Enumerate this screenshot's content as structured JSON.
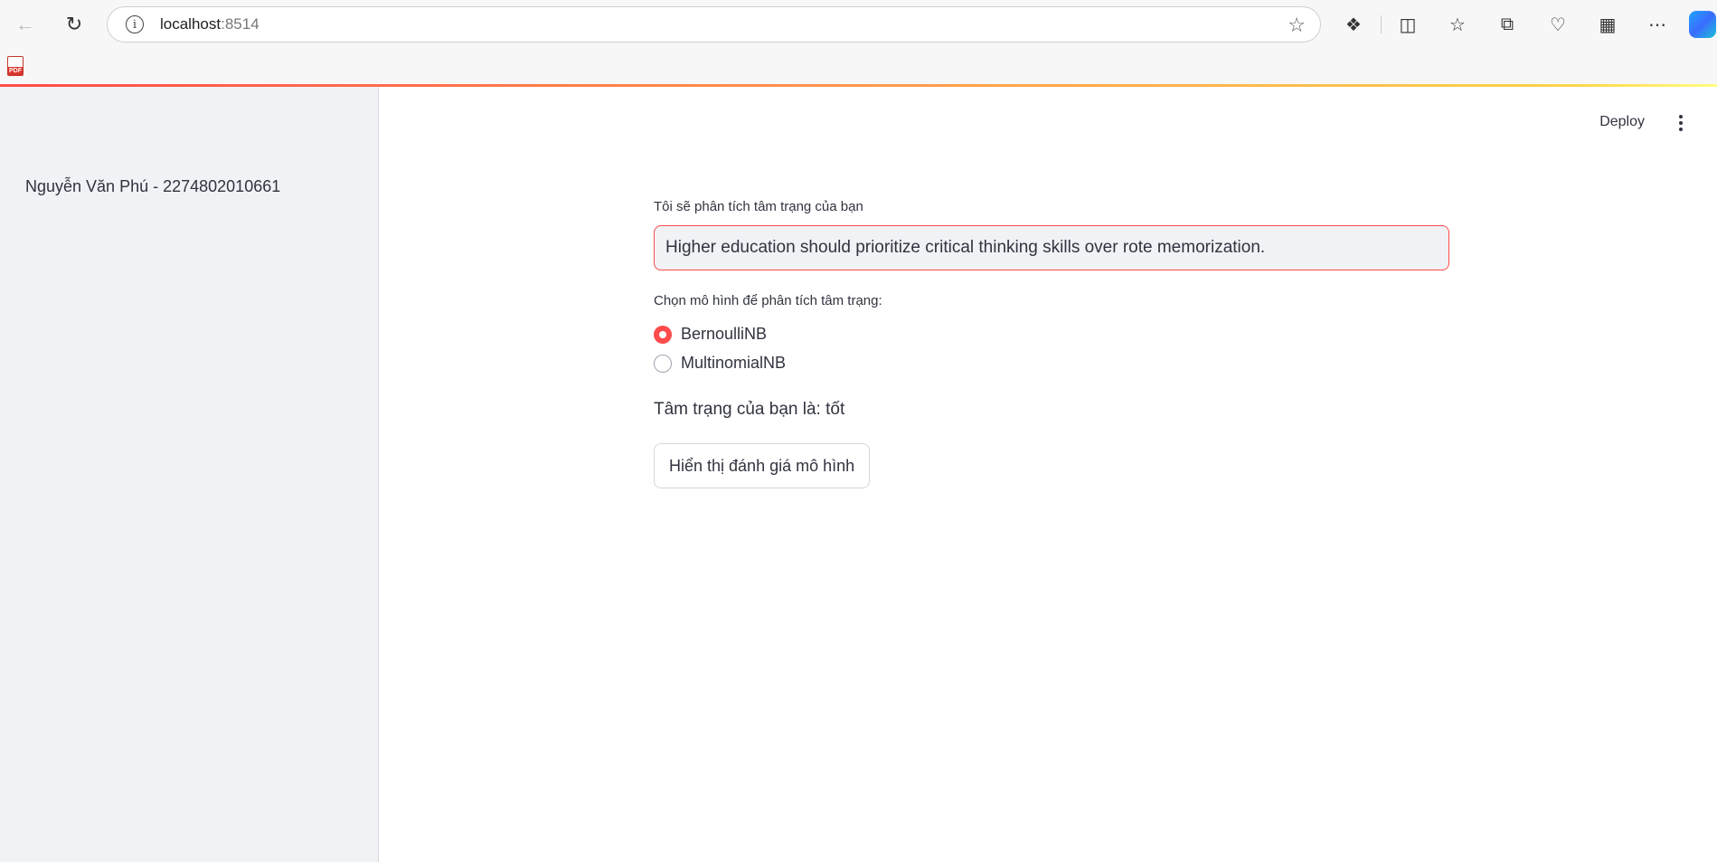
{
  "browser": {
    "url_host": "localhost",
    "url_port": ":8514"
  },
  "bookmarks": [
    {
      "icon": "pdf-icon",
      "label": "PDF"
    }
  ],
  "sidebar": {
    "author": "Nguyễn Văn Phú - 2274802010661"
  },
  "header": {
    "deploy_label": "Deploy"
  },
  "main": {
    "input_label": "Tôi sẽ phân tích tâm trạng của bạn",
    "input_value": "Higher education should prioritize critical thinking skills over rote memorization.",
    "radio_label": "Chọn mô hình để phân tích tâm trạng:",
    "radio_options": [
      {
        "label": "BernoulliNB",
        "checked": true
      },
      {
        "label": "MultinomialNB",
        "checked": false
      }
    ],
    "result": "Tâm trạng của bạn là: tốt",
    "eval_button": "Hiển thị đánh giá mô hình"
  },
  "colors": {
    "accent": "#ff4b4b",
    "sidebar_bg": "#f0f2f6",
    "text": "#31333f"
  }
}
